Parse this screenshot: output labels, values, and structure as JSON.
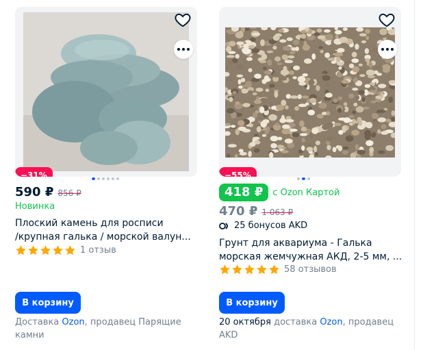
{
  "colors": {
    "accent": "#005bff",
    "discount": "#f91155",
    "green": "#10c44c",
    "star": "#ffa800",
    "muted": "#707f8d"
  },
  "products": [
    {
      "discount": "−31%",
      "price": "590 ₽",
      "old_price": "856 ₽",
      "badge": "Новинка",
      "title_line1": "Плоский камень для росписи",
      "title_line2": "/крупная галька / морской валун...",
      "rating": 5,
      "reviews": "1 отзыв",
      "cart_label": "В корзину",
      "delivery_prefix": "Доставка",
      "delivery_brand": "Ozon",
      "delivery_suffix": ", продавец Парящие",
      "delivery_line2": "камни",
      "image_slides": 6,
      "active_slide": 1
    },
    {
      "discount": "−55%",
      "card_price": "418 ₽",
      "card_label": "с Ozon Картой",
      "price": "470 ₽",
      "old_price": "1 063 ₽",
      "bonus": "25 бонусов AKD",
      "title_line1": "Грунт для аквариума - Галька",
      "title_line2": "морская жемчужная АКД, 2-5 мм, ...",
      "rating": 5,
      "reviews": "58 отзывов",
      "cart_label": "В корзину",
      "delivery_date": "20 октября",
      "delivery_middle": "доставка",
      "delivery_brand": "Ozon",
      "delivery_suffix": ", продавец",
      "delivery_line2": "AKD",
      "image_slides": 3,
      "active_slide": 2
    }
  ],
  "icons": {
    "favorite": "heart-icon",
    "more": "more-dots-icon",
    "star": "star-icon",
    "bonus": "bonus-icon"
  }
}
